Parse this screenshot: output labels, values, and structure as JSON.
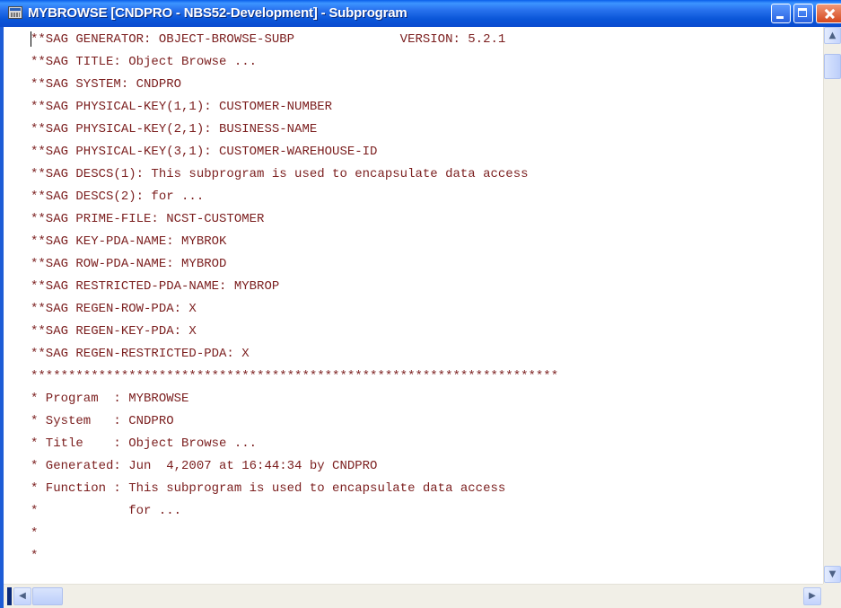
{
  "window": {
    "title": "MYBROWSE [CNDPRO - NBS52-Development] - Subprogram",
    "icon": "app-window-icon"
  },
  "editor": {
    "text_color": "#7b1e1e",
    "lines": [
      "**SAG GENERATOR: OBJECT-BROWSE-SUBP              VERSION: 5.2.1",
      "**SAG TITLE: Object Browse ...",
      "**SAG SYSTEM: CNDPRO",
      "**SAG PHYSICAL-KEY(1,1): CUSTOMER-NUMBER",
      "**SAG PHYSICAL-KEY(2,1): BUSINESS-NAME",
      "**SAG PHYSICAL-KEY(3,1): CUSTOMER-WAREHOUSE-ID",
      "**SAG DESCS(1): This subprogram is used to encapsulate data access",
      "**SAG DESCS(2): for ...",
      "**SAG PRIME-FILE: NCST-CUSTOMER",
      "**SAG KEY-PDA-NAME: MYBROK",
      "**SAG ROW-PDA-NAME: MYBROD",
      "**SAG RESTRICTED-PDA-NAME: MYBROP",
      "**SAG REGEN-ROW-PDA: X",
      "**SAG REGEN-KEY-PDA: X",
      "**SAG REGEN-RESTRICTED-PDA: X",
      "**********************************************************************",
      "* Program  : MYBROWSE",
      "* System   : CNDPRO",
      "* Title    : Object Browse ...",
      "* Generated: Jun  4,2007 at 16:44:34 by CNDPRO",
      "* Function : This subprogram is used to encapsulate data access",
      "*            for ...",
      "*",
      "*"
    ]
  },
  "scrollbars": {
    "vertical_up": "▲",
    "vertical_down": "▼",
    "horizontal_left": "◀",
    "horizontal_right": "▶"
  }
}
